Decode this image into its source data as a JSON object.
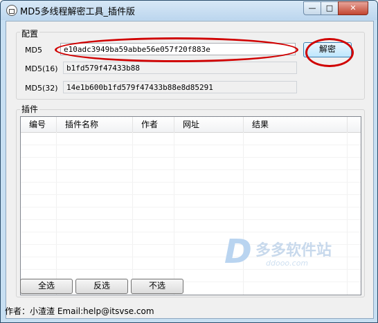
{
  "window": {
    "title": "MD5多线程解密工具_插件版",
    "controls": {
      "minimize": "—",
      "maximize": "□",
      "close": "✕"
    }
  },
  "config": {
    "label": "配置",
    "md5_label": "MD5",
    "md5_value": "e10adc3949ba59abbe56e057f20f883e",
    "decrypt_label": "解密",
    "md5_16_label": "MD5(16)",
    "md5_16_value": "b1fd579f47433b88",
    "md5_32_label": "MD5(32)",
    "md5_32_value": "14e1b600b1fd579f47433b88e8d85291"
  },
  "plugins": {
    "label": "插件",
    "columns": [
      "编号",
      "插件名称",
      "作者",
      "网址",
      "结果"
    ],
    "rows": []
  },
  "buttons": {
    "select_all": "全选",
    "invert": "反选",
    "select_none": "不选"
  },
  "status": {
    "text": "作者：小渣渣 Email:help@itsvse.com"
  },
  "watermark": {
    "logo": "D",
    "text": "多多软件站",
    "sub": "ddooo.com"
  },
  "colors": {
    "annotation": "#d00000"
  }
}
